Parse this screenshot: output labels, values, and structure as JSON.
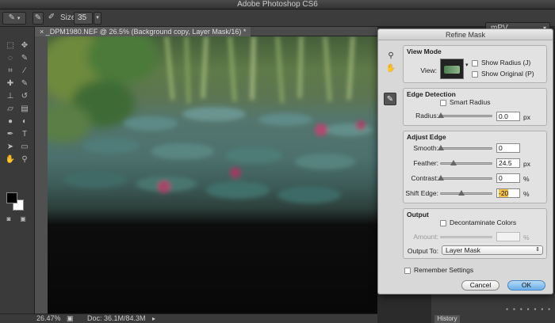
{
  "app": {
    "title": "Adobe Photoshop CS6"
  },
  "options_bar": {
    "size_label": "Size:",
    "size_value": "35",
    "workspace": "mPV"
  },
  "document": {
    "tab_title": "_DPM1980.NEF @ 26.5% (Background copy, Layer Mask/16) *"
  },
  "status": {
    "zoom": "26.47%",
    "doc_info": "Doc: 36.1M/84.3M"
  },
  "panels": {
    "history_tab": "History"
  },
  "dialog": {
    "title": "Refine Mask",
    "view_mode": {
      "heading": "View Mode",
      "view_label": "View:",
      "show_radius": {
        "label": "Show Radius (J)",
        "checked": false
      },
      "show_original": {
        "label": "Show Original (P)",
        "checked": false
      }
    },
    "edge_detection": {
      "heading": "Edge Detection",
      "smart_radius": {
        "label": "Smart Radius",
        "checked": false
      },
      "radius": {
        "label": "Radius:",
        "value": "0.0",
        "unit": "px",
        "level": 0
      }
    },
    "adjust_edge": {
      "heading": "Adjust Edge",
      "smooth": {
        "label": "Smooth:",
        "value": "0",
        "unit": "",
        "level": 0
      },
      "feather": {
        "label": "Feather:",
        "value": "24.5",
        "unit": "px",
        "level": 0.245
      },
      "contrast": {
        "label": "Contrast:",
        "value": "0",
        "unit": "%",
        "level": 0
      },
      "shift_edge": {
        "label": "Shift Edge:",
        "value": "-20",
        "unit": "%",
        "level": 0.4
      }
    },
    "output": {
      "heading": "Output",
      "decontaminate": {
        "label": "Decontaminate Colors",
        "checked": false
      },
      "amount": {
        "label": "Amount:",
        "value": "",
        "unit": "%"
      },
      "output_to": {
        "label": "Output To:",
        "selected": "Layer Mask"
      }
    },
    "remember": {
      "label": "Remember Settings",
      "checked": false
    },
    "buttons": {
      "cancel": "Cancel",
      "ok": "OK"
    }
  }
}
